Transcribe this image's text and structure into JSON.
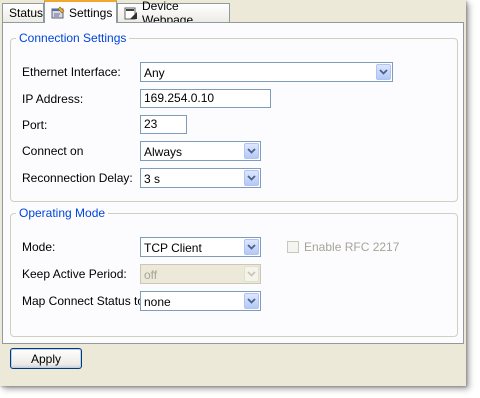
{
  "tabs": [
    {
      "label": "Status"
    },
    {
      "label": "Settings"
    },
    {
      "label": "Device Webpage"
    }
  ],
  "connection_settings": {
    "legend": "Connection Settings",
    "ethernet_interface": {
      "label": "Ethernet Interface:",
      "value": "Any"
    },
    "ip_address": {
      "label": "IP Address:",
      "value": "169.254.0.10"
    },
    "port": {
      "label": "Port:",
      "value": "23"
    },
    "connect_on": {
      "label": "Connect on",
      "value": "Always"
    },
    "reconnection_delay": {
      "label": "Reconnection Delay:",
      "value": "3 s"
    }
  },
  "operating_mode": {
    "legend": "Operating Mode",
    "mode": {
      "label": "Mode:",
      "value": "TCP Client"
    },
    "enable_rfc": {
      "label": "Enable RFC 2217",
      "checked": false,
      "enabled": false
    },
    "keep_active_period": {
      "label": "Keep Active Period:",
      "value": "off",
      "enabled": false
    },
    "map_connect_status": {
      "label": "Map Connect Status to",
      "value": "none"
    }
  },
  "apply_button": {
    "label": "Apply"
  },
  "colors": {
    "window_bg": "#ECE9D8",
    "legend_text": "#0046D5",
    "active_tab_accent": "#F0A830"
  }
}
